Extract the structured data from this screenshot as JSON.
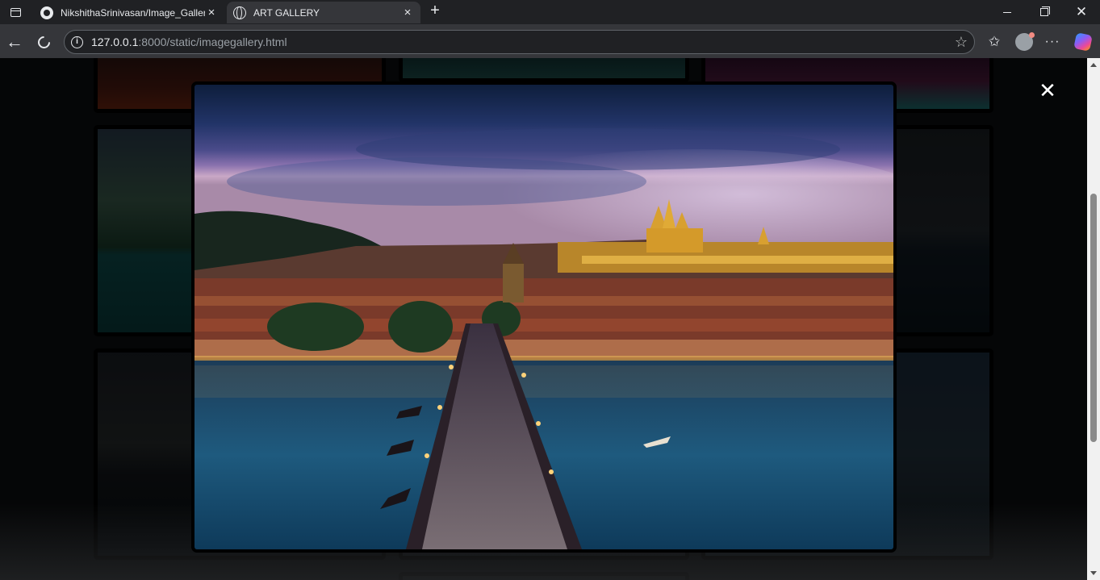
{
  "browser": {
    "tabs": [
      {
        "title": "NikshithaSrinivasan/Image_Gallery",
        "icon": "github-icon",
        "active": false
      },
      {
        "title": "ART GALLERY",
        "icon": "globe-icon",
        "active": true
      }
    ],
    "address": {
      "host": "127.0.0.1",
      "rest": ":8000/static/imagegallery.html"
    }
  },
  "page": {
    "close_symbol": "✕"
  },
  "colors": {
    "chrome_dark": "#202124",
    "chrome_toolbar": "#35363a",
    "page_background": "#0c0e10",
    "modal_border": "#000000"
  }
}
